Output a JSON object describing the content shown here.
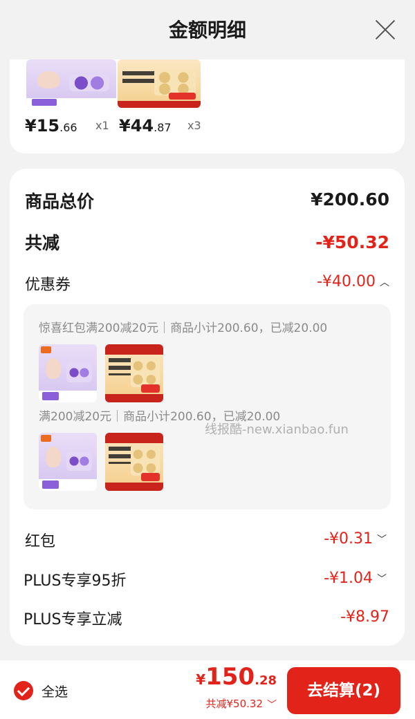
{
  "header": {
    "title": "金额明细"
  },
  "products_top": [
    {
      "price_int": "¥15",
      "price_dec": ".66",
      "qty": "x1"
    },
    {
      "price_int": "¥44",
      "price_dec": ".87",
      "qty": "x3"
    }
  ],
  "summary": {
    "total_label": "商品总价",
    "total_value": "¥200.60",
    "reduce_label": "共减",
    "reduce_value": "-¥50.32"
  },
  "coupon": {
    "label": "优惠券",
    "value": "-¥40.00",
    "lines": [
      "惊喜红包满200减20元｜商品小计200.60，已减20.00",
      "满200减20元｜商品小计200.60，已减20.00"
    ]
  },
  "discounts": [
    {
      "label": "红包",
      "value": "-¥0.31"
    },
    {
      "label": "PLUS专享95折",
      "value": "-¥1.04"
    },
    {
      "label": "PLUS专享立减",
      "value": "-¥8.97"
    }
  ],
  "watermark": "线报酷-new.xianbao.fun",
  "footer": {
    "select_all": "全选",
    "total_symbol": "¥",
    "total_int": "150",
    "total_dec": ".28",
    "reduce_text": "共减¥50.32",
    "checkout_label": "去结算(2)"
  },
  "colors": {
    "accent": "#e2231a",
    "background": "#f2f2f2"
  }
}
